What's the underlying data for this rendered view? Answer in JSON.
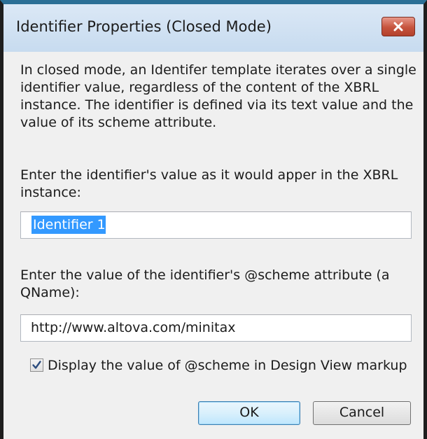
{
  "window": {
    "title": "Identifier Properties (Closed Mode)"
  },
  "description": "In closed mode, an Identifer template iterates over a single identifier value, regardless of the content of the XBRL instance. The identifier is defined via its text value and the value of its scheme attribute.",
  "value_field": {
    "label": "Enter the identifier's value as it would apper in the XBRL instance:",
    "value": "Identifier 1",
    "selected": true
  },
  "scheme_field": {
    "label": "Enter the value of the identifier's @scheme attribute (a QName):",
    "value": "http://www.altova.com/minitax"
  },
  "display_scheme_checkbox": {
    "label": "Display the value of @scheme in Design View markup",
    "checked": true
  },
  "buttons": {
    "ok": "OK",
    "cancel": "Cancel"
  },
  "colors": {
    "title_bar": "#c7dbef",
    "close_button": "#c6533d",
    "selection": "#3399ff",
    "default_button_border": "#3c7fb1"
  }
}
